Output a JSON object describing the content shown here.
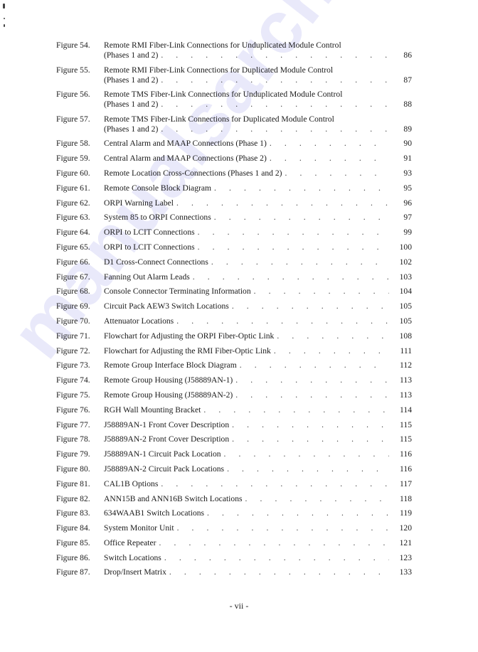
{
  "watermark": "manualsarchive.com",
  "footer": {
    "page_label": "- vii -"
  },
  "leader_dots": ". . . . . . . . . . . . . . . . . . . . . . . . . . . . . . . . . . . . . . . . .",
  "entries": [
    {
      "label": "Figure 54.",
      "title_line1": "Remote RMI Fiber-Link Connections for Unduplicated Module Control",
      "title": "(Phases 1 and 2)",
      "page": "86"
    },
    {
      "label": "Figure 55.",
      "title_line1": "Remote RMI Fiber-Link Connections for Duplicated Module Control",
      "title": "(Phases 1 and 2)",
      "page": "87"
    },
    {
      "label": "Figure 56.",
      "title_line1": "Remote TMS Fiber-Link Connections for Unduplicated Module Control",
      "title": "(Phases 1 and 2)",
      "page": "88"
    },
    {
      "label": "Figure 57.",
      "title_line1": "Remote TMS Fiber-Link Connections for Duplicated Module Control",
      "title": "(Phases 1 and 2)",
      "page": "89"
    },
    {
      "label": "Figure 58.",
      "title": "Central Alarm and MAAP Connections (Phase 1)",
      "page": "90"
    },
    {
      "label": "Figure 59.",
      "title": "Central Alarm and MAAP Connections (Phase 2)",
      "page": "91"
    },
    {
      "label": "Figure 60.",
      "title": "Remote Location Cross-Connections (Phases 1 and 2)",
      "page": "93"
    },
    {
      "label": "Figure 61.",
      "title": "Remote Console Block Diagram",
      "page": "95"
    },
    {
      "label": "Figure 62.",
      "title": "ORPI Warning Label",
      "page": "96"
    },
    {
      "label": "Figure 63.",
      "title": "System 85 to ORPI Connections",
      "page": "97"
    },
    {
      "label": "Figure 64.",
      "title": "ORPI to LCIT Connections",
      "page": "99"
    },
    {
      "label": "Figure 65.",
      "title": "ORPI to LCIT Connections",
      "page": "100"
    },
    {
      "label": "Figure 66.",
      "title": "D1 Cross-Connect Connections",
      "page": "102"
    },
    {
      "label": "Figure 67.",
      "title": "Fanning Out Alarm Leads",
      "page": "103"
    },
    {
      "label": "Figure 68.",
      "title": "Console Connector Terminating Information",
      "page": "104"
    },
    {
      "label": "Figure 69.",
      "title": "Circuit Pack AEW3 Switch Locations",
      "page": "105"
    },
    {
      "label": "Figure 70.",
      "title": "Attenuator Locations",
      "page": "105"
    },
    {
      "label": "Figure 71.",
      "title": "Flowchart for Adjusting the ORPI Fiber-Optic Link",
      "page": "108"
    },
    {
      "label": "Figure 72.",
      "title": "Flowchart for Adjusting the RMI Fiber-Optic Link",
      "page": "111"
    },
    {
      "label": "Figure 73.",
      "title": "Remote Group Interface Block Diagram",
      "page": "112"
    },
    {
      "label": "Figure 74.",
      "title": "Remote Group Housing (J58889AN-1)",
      "page": "113"
    },
    {
      "label": "Figure 75.",
      "title": "Remote Group Housing (J58889AN-2)",
      "page": "113"
    },
    {
      "label": "Figure 76.",
      "title": "RGH Wall Mounting Bracket",
      "page": "114"
    },
    {
      "label": "Figure 77.",
      "title": "J58889AN-1 Front Cover Description",
      "page": "115"
    },
    {
      "label": "Figure 78.",
      "title": "J58889AN-2 Front Cover Description",
      "page": "115"
    },
    {
      "label": "Figure 79.",
      "title": "J58889AN-1 Circuit Pack Location",
      "page": "116"
    },
    {
      "label": "Figure 80.",
      "title": "J58889AN-2 Circuit Pack Locations",
      "page": "116"
    },
    {
      "label": "Figure 81.",
      "title": "CAL1B Options",
      "page": "117"
    },
    {
      "label": "Figure 82.",
      "title": "ANN15B and ANN16B Switch Locations",
      "page": "118"
    },
    {
      "label": "Figure 83.",
      "title": "634WAAB1 Switch Locations",
      "page": "119"
    },
    {
      "label": "Figure 84.",
      "title": "System Monitor Unit",
      "page": "120"
    },
    {
      "label": "Figure 85.",
      "title": "Office Repeater",
      "page": "121"
    },
    {
      "label": "Figure 86.",
      "title": "Switch Locations",
      "page": "123"
    },
    {
      "label": "Figure 87.",
      "title": "Drop/Insert Matrix",
      "page": "133"
    }
  ]
}
